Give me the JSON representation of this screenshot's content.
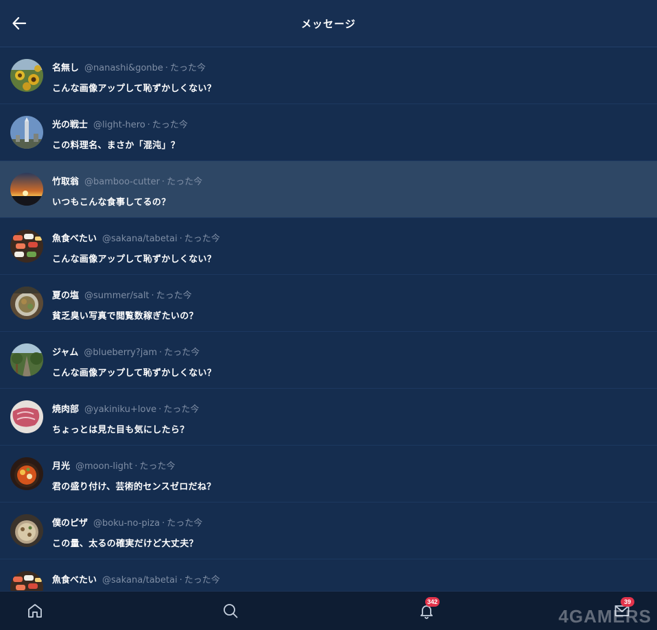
{
  "header": {
    "title": "メッセージ",
    "back_icon": "arrow-left-icon"
  },
  "messages": [
    {
      "name": "名無し",
      "handle": "@nanashi&gonbe",
      "time": "たった今",
      "text": "こんな画像アップして恥ずかしくない？",
      "avatar": "sunflower"
    },
    {
      "name": "光の戦士",
      "handle": "@light-hero",
      "time": "たった今",
      "text": "この料理名、まさか「混沌」？",
      "avatar": "tower"
    },
    {
      "name": "竹取翁",
      "handle": "@bamboo-cutter",
      "time": "たった今",
      "text": "いつもこんな食事してるの？",
      "avatar": "sunset"
    },
    {
      "name": "魚食べたい",
      "handle": "@sakana/tabetai",
      "time": "たった今",
      "text": "こんな画像アップして恥ずかしくない？",
      "avatar": "sushi"
    },
    {
      "name": "夏の塩",
      "handle": "@summer/salt",
      "time": "たった今",
      "text": "貧乏臭い写真で閲覧数稼ぎたいの？",
      "avatar": "food"
    },
    {
      "name": "ジャム",
      "handle": "@blueberry?jam",
      "time": "たった今",
      "text": "こんな画像アップして恥ずかしくない？",
      "avatar": "path"
    },
    {
      "name": "焼肉部",
      "handle": "@yakiniku+love",
      "time": "たった今",
      "text": "ちょっとは見た目も気にしたら？",
      "avatar": "meat"
    },
    {
      "name": "月光",
      "handle": "@moon-light",
      "time": "たった今",
      "text": "君の盛り付け、芸術的センスゼロだね？",
      "avatar": "soup"
    },
    {
      "name": "僕のピザ",
      "handle": "@boku-no-piza",
      "time": "たった今",
      "text": "この量、太るの確実だけど大丈夫？",
      "avatar": "pizza"
    },
    {
      "name": "魚食べたい",
      "handle": "@sakana/tabetai",
      "time": "たった今",
      "text": "",
      "avatar": "sushi"
    }
  ],
  "highlighted_index": 2,
  "nav": {
    "home_icon": "home-icon",
    "search_icon": "search-icon",
    "bell_icon": "bell-icon",
    "bell_badge": "342",
    "mail_icon": "mail-icon",
    "mail_badge": "39"
  },
  "watermark": "4GAMERS",
  "colors": {
    "background": "#152d4f",
    "highlight": "#2e4765",
    "badge": "#e2334b",
    "nav": "#0e1d33"
  }
}
